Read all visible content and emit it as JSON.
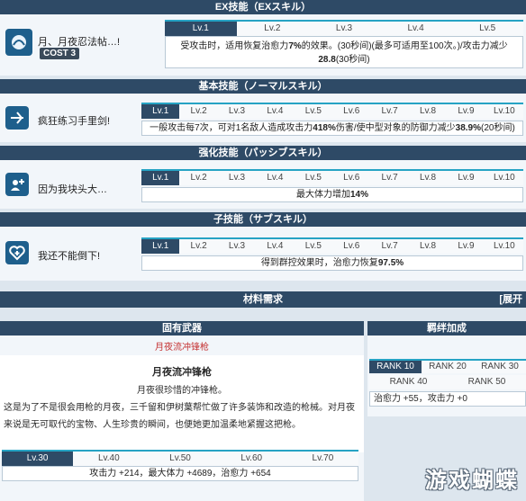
{
  "ex": {
    "header": "EX技能（EXスキル）",
    "name": "月、月夜忍法帖…!",
    "cost": "COST 3",
    "tabs": [
      "Lv.1",
      "Lv.2",
      "Lv.3",
      "Lv.4",
      "Lv.5"
    ],
    "desc_pre": "受攻击时，适用恢复治愈力",
    "desc_b1": "7%",
    "desc_mid": "的效果。(30秒间)(最多可适用至100次。)/攻击力减少",
    "desc_b2": "28.8",
    "desc_post": "(30秒间)"
  },
  "basic": {
    "header": "基本技能（ノーマルスキル）",
    "name": "疯狂练习手里剑!",
    "tabs": [
      "Lv.1",
      "Lv.2",
      "Lv.3",
      "Lv.4",
      "Lv.5",
      "Lv.6",
      "Lv.7",
      "Lv.8",
      "Lv.9",
      "Lv.10"
    ],
    "desc_pre": "一般攻击每7次，可对1名敌人造成攻击力",
    "desc_b1": "418%",
    "desc_mid": "伤害/使中型对象的防御力减少",
    "desc_b2": "38.9%",
    "desc_post": "(20秒间)"
  },
  "enhance": {
    "header": "强化技能（パッシブスキル）",
    "name": "因为我块头大…",
    "tabs": [
      "Lv.1",
      "Lv.2",
      "Lv.3",
      "Lv.4",
      "Lv.5",
      "Lv.6",
      "Lv.7",
      "Lv.8",
      "Lv.9",
      "Lv.10"
    ],
    "desc_pre": "最大体力增加",
    "desc_b1": "14%"
  },
  "sub": {
    "header": "子技能（サブスキル）",
    "name": "我还不能倒下!",
    "tabs": [
      "Lv.1",
      "Lv.2",
      "Lv.3",
      "Lv.4",
      "Lv.5",
      "Lv.6",
      "Lv.7",
      "Lv.8",
      "Lv.9",
      "Lv.10"
    ],
    "desc_pre": "得到群控效果时，治愈力恢复",
    "desc_b1": "97.5%"
  },
  "materials": {
    "header": "材料需求",
    "expand": "[展开"
  },
  "weapon": {
    "header": "固有武器",
    "name_red": "月夜流冲锋枪",
    "title": "月夜流冲锋枪",
    "line1": "月夜很珍惜的冲锋枪。",
    "line2": "这是为了不是很会用枪的月夜，三千留和伊树葉帮忙做了许多装饰和改造的枪械。对月夜",
    "line3": "来说是无可取代的宝物、人生珍贵的瞬间，也便她更加温柔地紧握这把枪。",
    "tabs": [
      "Lv.30",
      "Lv.40",
      "Lv.50",
      "Lv.60",
      "Lv.70"
    ],
    "stats": "攻击力 +214，最大体力 +4689，治愈力 +654"
  },
  "bond": {
    "header": "羁绊加成",
    "ranks_row1": [
      "RANK 10",
      "RANK 20",
      "RANK 30"
    ],
    "ranks_row2": [
      "RANK 40",
      "RANK 50"
    ],
    "stats": "治愈力 +55，攻击力 +0"
  },
  "watermark": "游戏蝴蝶"
}
